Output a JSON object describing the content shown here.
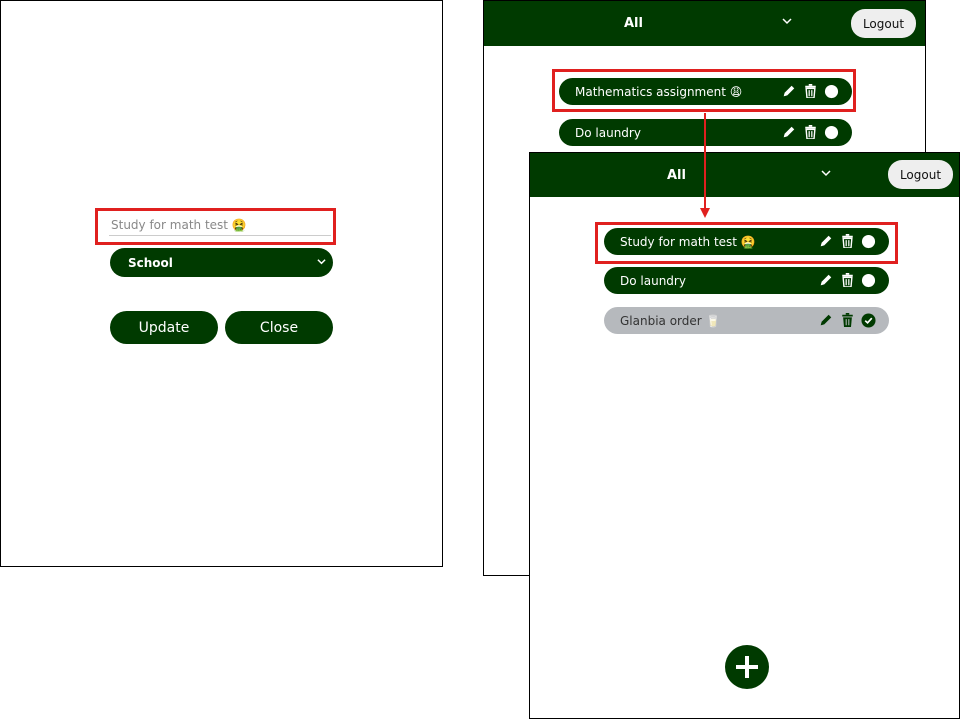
{
  "colors": {
    "primary": "#003a00",
    "highlight": "#e0201f",
    "done_bg": "#b6b9bd",
    "white": "#ffffff"
  },
  "edit_panel": {
    "task_input": {
      "value": "Study for math test 🤮"
    },
    "category_select": {
      "value": "School",
      "icon": "chevron-down-icon"
    },
    "update_label": "Update",
    "close_label": "Close"
  },
  "panel_before": {
    "filter": "All",
    "logout_label": "Logout",
    "todos": [
      {
        "text": "Mathematics assignment 😩",
        "done": false
      },
      {
        "text": "Do laundry",
        "done": false
      }
    ]
  },
  "panel_after": {
    "filter": "All",
    "logout_label": "Logout",
    "todos": [
      {
        "text": "Study for math test 🤮",
        "done": false
      },
      {
        "text": "Do laundry",
        "done": false
      },
      {
        "text": "Glanbia order 🥛",
        "done": true
      }
    ],
    "add_icon": "plus-icon"
  }
}
